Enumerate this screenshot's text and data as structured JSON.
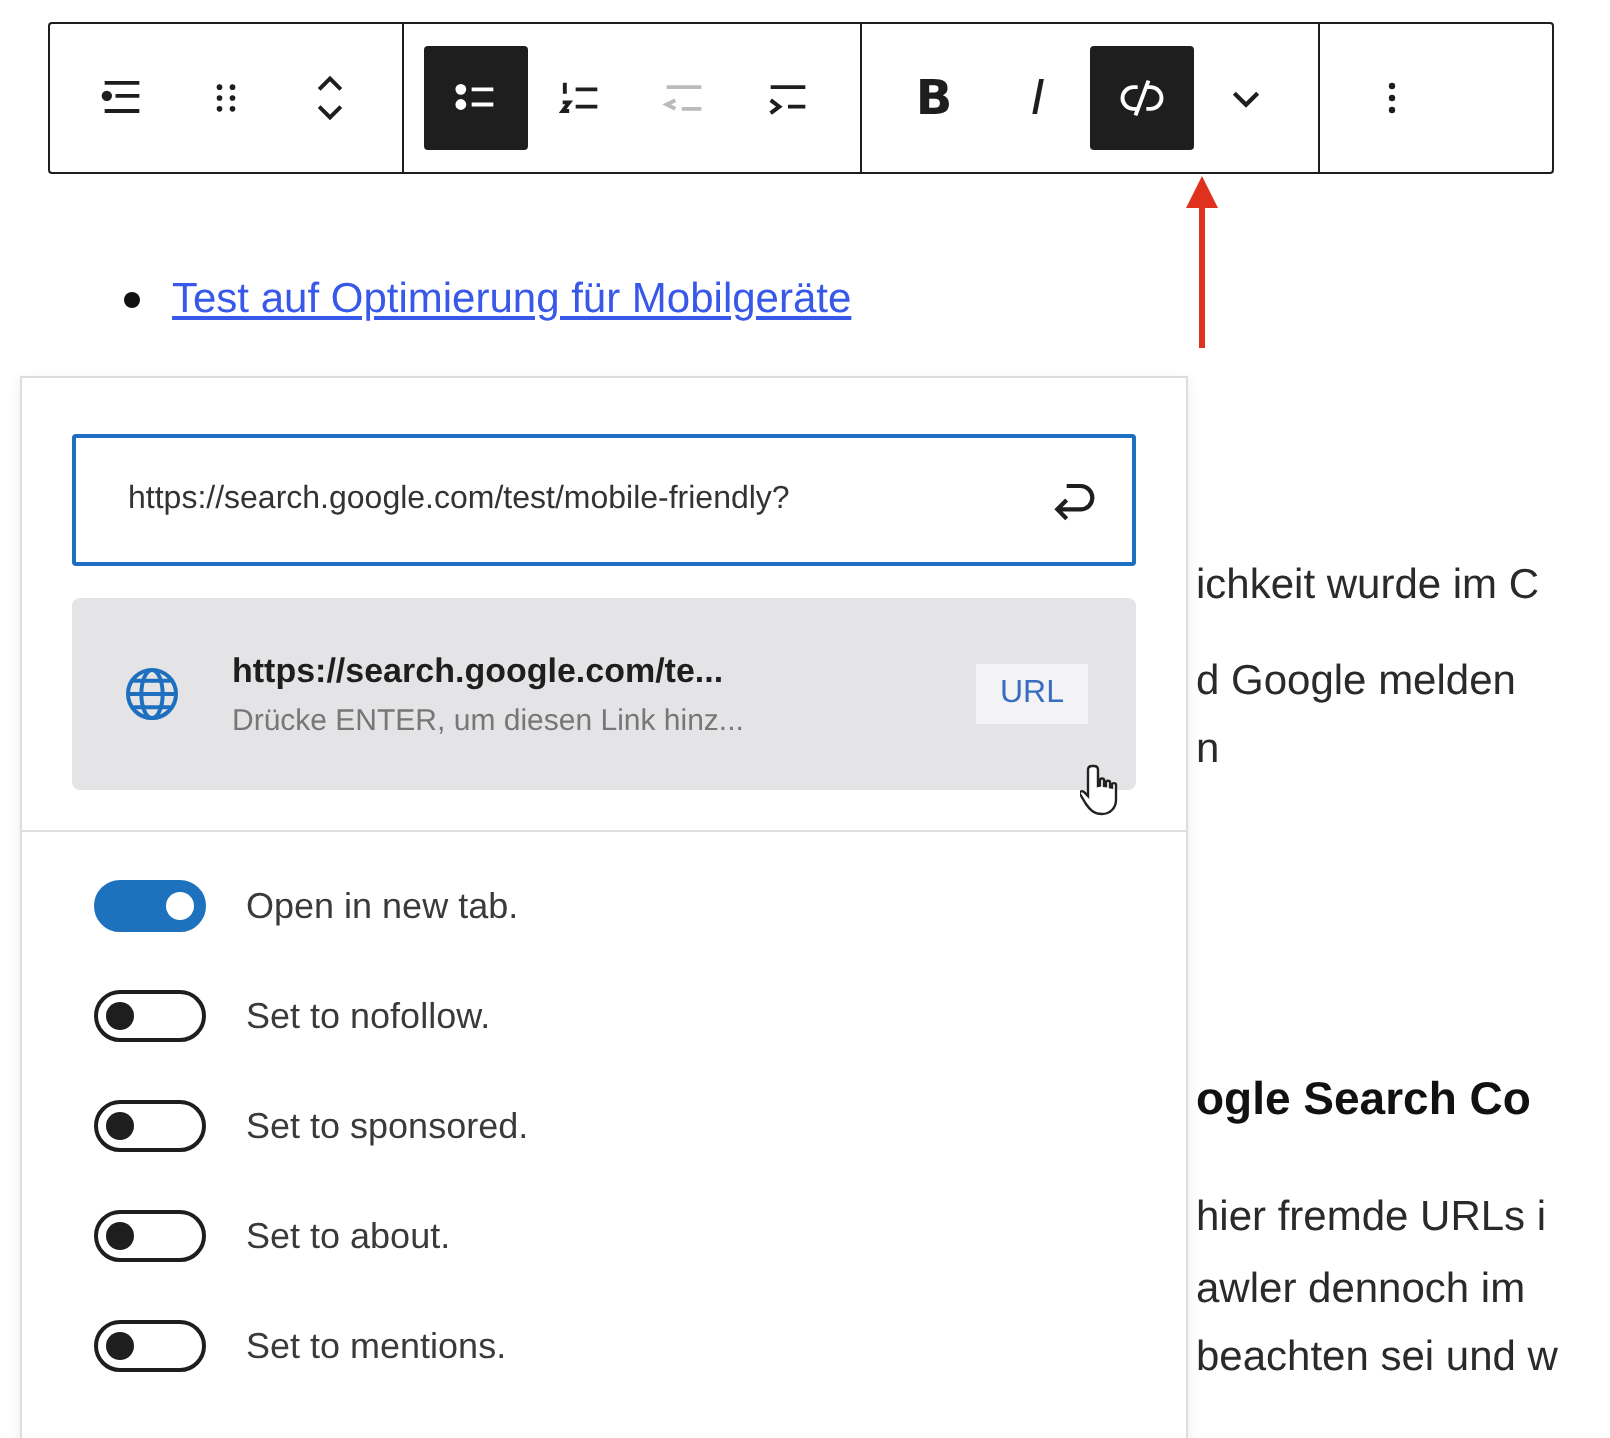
{
  "toolbar": {
    "groups": [
      {
        "buttons": [
          {
            "kind": "list-block",
            "selected": false,
            "disabled": false
          },
          {
            "kind": "drag",
            "selected": false,
            "disabled": false
          },
          {
            "kind": "move",
            "selected": false,
            "disabled": false
          }
        ]
      },
      {
        "buttons": [
          {
            "kind": "bullets",
            "selected": true,
            "disabled": false
          },
          {
            "kind": "numbers",
            "selected": false,
            "disabled": false
          },
          {
            "kind": "outdent",
            "selected": false,
            "disabled": true
          },
          {
            "kind": "indent",
            "selected": false,
            "disabled": false
          }
        ]
      },
      {
        "buttons": [
          {
            "kind": "bold",
            "label": "B",
            "selected": false,
            "disabled": false
          },
          {
            "kind": "italic",
            "label": "I",
            "selected": false,
            "disabled": false
          },
          {
            "kind": "unlink",
            "selected": true,
            "disabled": false
          },
          {
            "kind": "chevron",
            "selected": false,
            "disabled": false
          }
        ]
      },
      {
        "buttons": [
          {
            "kind": "more",
            "selected": false,
            "disabled": false
          }
        ]
      }
    ]
  },
  "article": {
    "list_item": "Test auf Optimierung für Mobilgeräte",
    "fragments_top": [
      "ichkeit wurde im C",
      "d Google melden",
      "n"
    ],
    "heading": "ogle Search Co",
    "fragments_bottom": [
      "hier fremde URLs i",
      "awler dennoch im",
      "beachten sei und w"
    ]
  },
  "link_popover": {
    "url_field": {
      "value": "https://search.google.com/test/mobile-friendly?"
    },
    "suggestion": {
      "title": "https://search.google.com/te...",
      "hint": "Drücke ENTER, um diesen Link hinz...",
      "badge": "URL"
    },
    "options": [
      {
        "label": "Open in new tab.",
        "on": true
      },
      {
        "label": "Set to nofollow.",
        "on": false
      },
      {
        "label": "Set to sponsored.",
        "on": false
      },
      {
        "label": "Set to about.",
        "on": false
      },
      {
        "label": "Set to mentions.",
        "on": false
      }
    ]
  }
}
